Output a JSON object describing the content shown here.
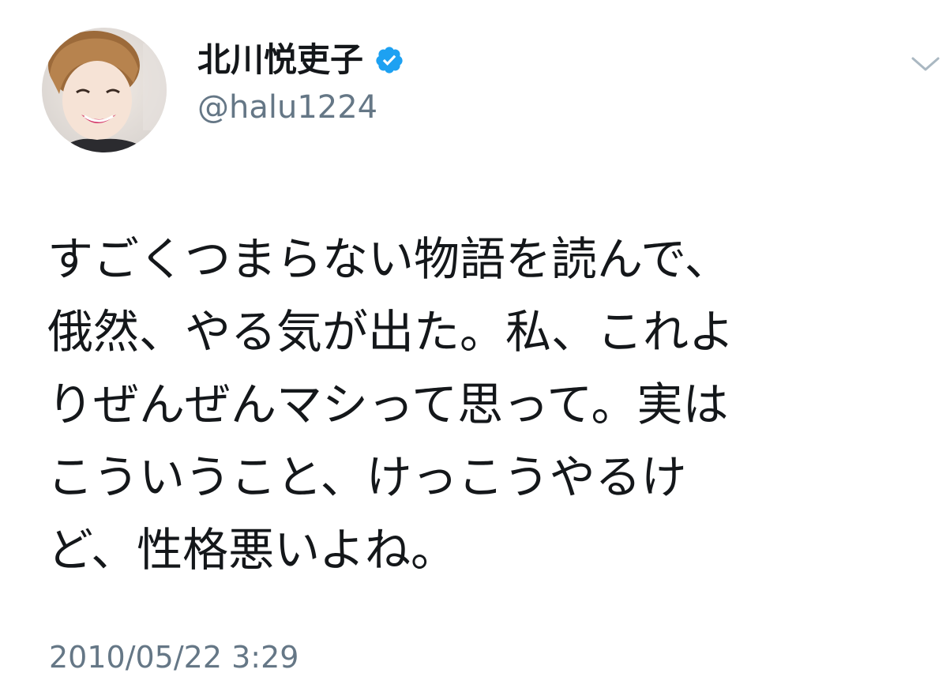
{
  "user": {
    "display_name": "北川悦吏子",
    "handle": "@halu1224",
    "verified": true,
    "avatar_icon": "profile-photo"
  },
  "tweet": {
    "text": "すごくつまらない物語を読んで、\n俄然、やる気が出た。私、これよ\nりぜんぜんマシって思って。実は\nこういうこと、けっこうやるけ\nど、性格悪いよね。",
    "timestamp": "2010/05/22 3:29"
  },
  "menu": {
    "icon": "chevron-down-icon"
  },
  "colors": {
    "text": "#14171a",
    "secondary": "#657786",
    "verified_badge": "#1da1f2",
    "caret": "#aab8c2"
  }
}
